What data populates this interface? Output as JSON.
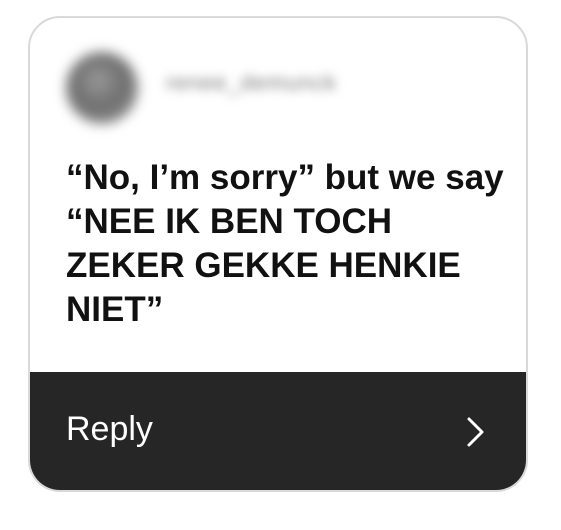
{
  "header": {
    "username": "renee_demunck",
    "avatar_icon": "avatar"
  },
  "message": {
    "text": "“No, I’m sorry” but we say “NEE IK BEN TOCH ZEKER GEKKE HENKIE NIET”"
  },
  "footer": {
    "reply_label": "Reply",
    "chevron_icon": "chevron-right-icon",
    "background": "#262626"
  }
}
